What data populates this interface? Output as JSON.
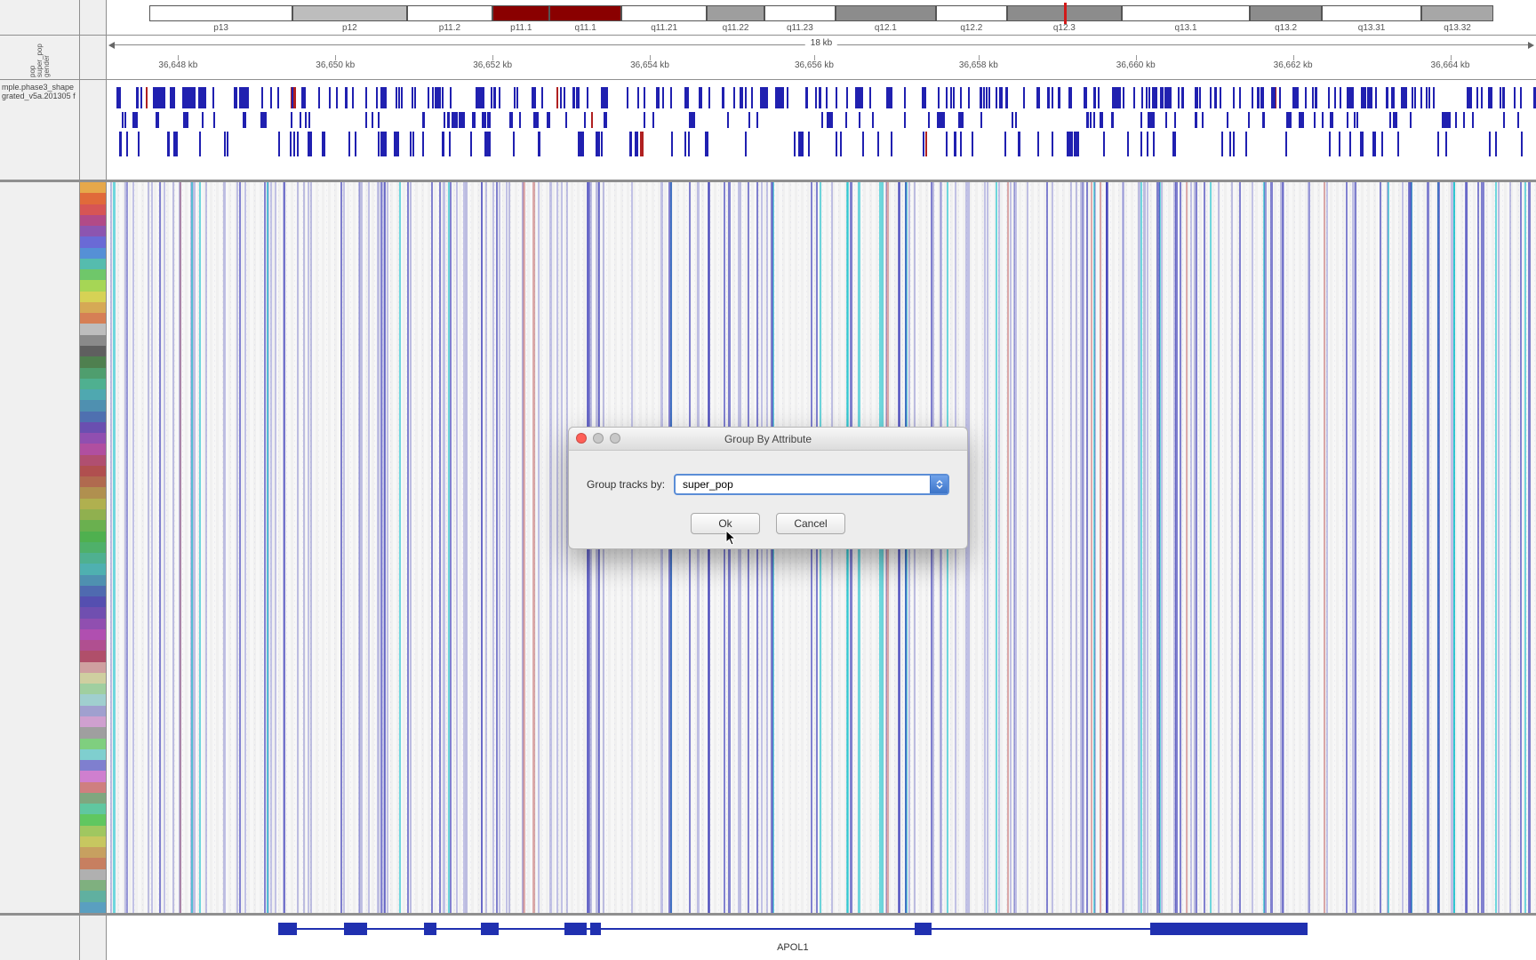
{
  "ideogram": {
    "bands": [
      {
        "name": "p13",
        "left_pct": 3,
        "width_pct": 10,
        "shade": "#fff"
      },
      {
        "name": "p12",
        "left_pct": 13,
        "width_pct": 8,
        "shade": "#bdbdbd"
      },
      {
        "name": "p11.2",
        "left_pct": 21,
        "width_pct": 6,
        "shade": "#fff"
      },
      {
        "name": "p11.1",
        "left_pct": 27,
        "width_pct": 4,
        "shade": "#8a0000"
      },
      {
        "name": "q11.1",
        "left_pct": 31,
        "width_pct": 5,
        "shade": "#8a0000"
      },
      {
        "name": "q11.21",
        "left_pct": 36,
        "width_pct": 6,
        "shade": "#fff"
      },
      {
        "name": "q11.22",
        "left_pct": 42,
        "width_pct": 4,
        "shade": "#9e9e9e"
      },
      {
        "name": "q11.23",
        "left_pct": 46,
        "width_pct": 5,
        "shade": "#fff"
      },
      {
        "name": "q12.1",
        "left_pct": 51,
        "width_pct": 7,
        "shade": "#8c8c8c"
      },
      {
        "name": "q12.2",
        "left_pct": 58,
        "width_pct": 5,
        "shade": "#fff"
      },
      {
        "name": "q12.3",
        "left_pct": 63,
        "width_pct": 8,
        "shade": "#8c8c8c"
      },
      {
        "name": "q13.1",
        "left_pct": 71,
        "width_pct": 9,
        "shade": "#fff"
      },
      {
        "name": "q13.2",
        "left_pct": 80,
        "width_pct": 5,
        "shade": "#8c8c8c"
      },
      {
        "name": "q13.31",
        "left_pct": 85,
        "width_pct": 7,
        "shade": "#fff"
      },
      {
        "name": "q13.32",
        "left_pct": 92,
        "width_pct": 5,
        "shade": "#a7a7a7"
      }
    ],
    "view_marker_pct": 67
  },
  "ruler": {
    "span_label": "18 kb",
    "gutter_labels": [
      "pop",
      "super_pop",
      "gender"
    ],
    "ticks": [
      {
        "label": "36,648 kb",
        "pct": 5
      },
      {
        "label": "36,650 kb",
        "pct": 16
      },
      {
        "label": "36,652 kb",
        "pct": 27
      },
      {
        "label": "36,654 kb",
        "pct": 38
      },
      {
        "label": "36,656 kb",
        "pct": 49.5
      },
      {
        "label": "36,658 kb",
        "pct": 61
      },
      {
        "label": "36,660 kb",
        "pct": 72
      },
      {
        "label": "36,662 kb",
        "pct": 83
      },
      {
        "label": "36,664 kb",
        "pct": 94
      }
    ]
  },
  "variant_header": {
    "gutter_text": "mple.phase3_shape grated_v5a.201305 f"
  },
  "attr_strip_colors": [
    "#e6a84a",
    "#e06a3a",
    "#d65555",
    "#b14a87",
    "#8c55b0",
    "#6a6ad6",
    "#5590d6",
    "#55bcae",
    "#6fc76a",
    "#a6d655",
    "#d6d255",
    "#d6a955",
    "#d67f55",
    "#bdbdbd",
    "#8a8a8a",
    "#5f5f5f",
    "#4f804f",
    "#4f9e6e",
    "#4fb090",
    "#4fa8b0",
    "#4f90b0",
    "#4f70b0",
    "#6a4fb0",
    "#904fb0",
    "#b04fa0",
    "#b04f70",
    "#b04f4f",
    "#b06a4f",
    "#b0904f",
    "#b0b04f",
    "#90b04f",
    "#6ab04f",
    "#4fb04f",
    "#4fb06a",
    "#4fb090",
    "#4fb0b0",
    "#4f90b0",
    "#4f6ab0",
    "#554fb0",
    "#704fb0",
    "#904fb0",
    "#b04fb0",
    "#b04f90",
    "#b04f6a",
    "#cfa0a0",
    "#cfcfa0",
    "#a0cfa0",
    "#a0cfcf",
    "#a0a0cf",
    "#cfa0cf",
    "#9f9f9f",
    "#7fcf7f",
    "#7fcfcf",
    "#7f7fcf",
    "#cf7fcf",
    "#cf7f7f",
    "#7fa77f",
    "#60c7a0",
    "#60c760",
    "#a0c760",
    "#c7c760",
    "#c7a060",
    "#c77f60",
    "#b0b0b0",
    "#7fb07f",
    "#60b0a0",
    "#5a9fc0"
  ],
  "gene": {
    "label": "APOL1",
    "line": {
      "left_pct": 12,
      "width_pct": 72
    },
    "exons": [
      {
        "left_pct": 12,
        "width_pct": 1.3
      },
      {
        "left_pct": 16.6,
        "width_pct": 1.6
      },
      {
        "left_pct": 22.2,
        "width_pct": 0.9
      },
      {
        "left_pct": 26.2,
        "width_pct": 1.2
      },
      {
        "left_pct": 32,
        "width_pct": 1.6
      },
      {
        "left_pct": 33.8,
        "width_pct": 0.8
      },
      {
        "left_pct": 56.5,
        "width_pct": 1.2
      },
      {
        "left_pct": 73,
        "width_pct": 11
      }
    ]
  },
  "dialog": {
    "title": "Group By Attribute",
    "field_label": "Group tracks by:",
    "value": "super_pop",
    "ok_label": "Ok",
    "cancel_label": "Cancel"
  },
  "variant_block_seed": 913,
  "variant_block_count": 420,
  "variant_column_seed": 2771,
  "variant_column_count": 210
}
